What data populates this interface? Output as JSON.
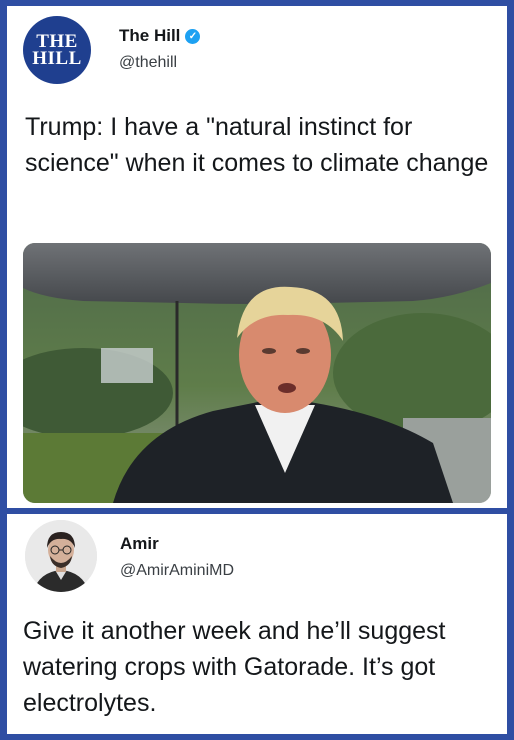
{
  "tweet": {
    "logo_line1": "THE",
    "logo_line2": "HILL",
    "display_name": "The Hill",
    "handle": "@thehill",
    "text": "Trump: I have a \"natural instinct for science\" when it comes to climate change",
    "image_icon": "photo-man-under-umbrella"
  },
  "reply": {
    "display_name": "Amir",
    "handle": "@AmirAminiMD",
    "text": "Give it another week and he’ll suggest watering crops with Gatorade. It’s got electrolytes.",
    "avatar_icon": "avatar-portrait"
  },
  "colors": {
    "frame": "#2f4ea3",
    "logo_bg": "#1f3f8f",
    "verified": "#1da1f2"
  }
}
